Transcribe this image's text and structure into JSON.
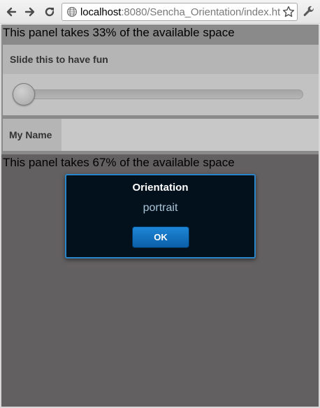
{
  "browser": {
    "url_host": "localhost",
    "url_rest": ":8080/Sencha_Orientation/index.ht"
  },
  "top_panel": {
    "title": "This panel takes 33% of the available space",
    "slider": {
      "label": "Slide this to have fun",
      "value_fraction": 0.0
    },
    "name_field": {
      "label": "My Name",
      "value": ""
    }
  },
  "bottom_panel": {
    "title": "This panel takes 67% of the available space"
  },
  "dialog": {
    "title": "Orientation",
    "message": "portrait",
    "ok_label": "OK",
    "accent_color": "#2b85c9"
  }
}
